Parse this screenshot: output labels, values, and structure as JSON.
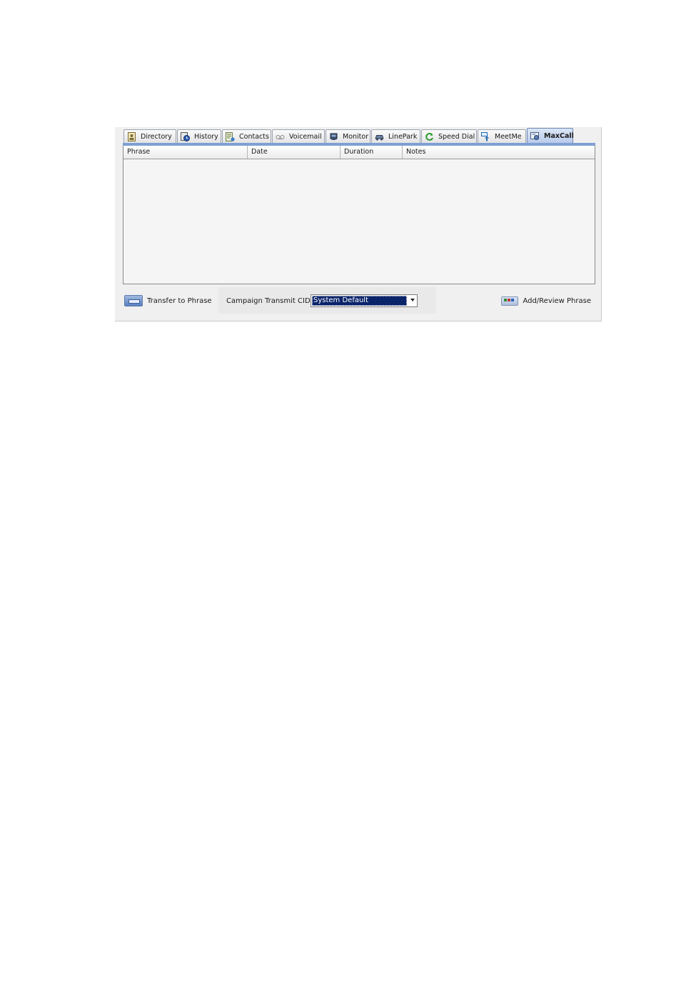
{
  "tabs": [
    {
      "label": "Directory",
      "icon": "directory-icon"
    },
    {
      "label": "History",
      "icon": "history-icon"
    },
    {
      "label": "Contacts",
      "icon": "contacts-icon"
    },
    {
      "label": "Voicemail",
      "icon": "voicemail-icon"
    },
    {
      "label": "Monitor",
      "icon": "monitor-icon"
    },
    {
      "label": "LinePark",
      "icon": "linepark-icon"
    },
    {
      "label": "Speed Dial",
      "icon": "speed-dial-icon"
    },
    {
      "label": "MeetMe",
      "icon": "meetme-icon"
    },
    {
      "label": "MaxCall",
      "icon": "maxcall-icon",
      "active": true
    }
  ],
  "table": {
    "columns": [
      "Phrase",
      "Date",
      "Duration",
      "Notes"
    ],
    "rows": []
  },
  "footer": {
    "transfer_label": "Transfer to Phrase",
    "cid_label": "Campaign Transmit CID:",
    "cid_value": "System Default",
    "add_label": "Add/Review Phrase"
  },
  "colors": {
    "accent_rule": "#7f9fd4",
    "active_tab": "#b9cbea",
    "selection": "#0a246a"
  }
}
